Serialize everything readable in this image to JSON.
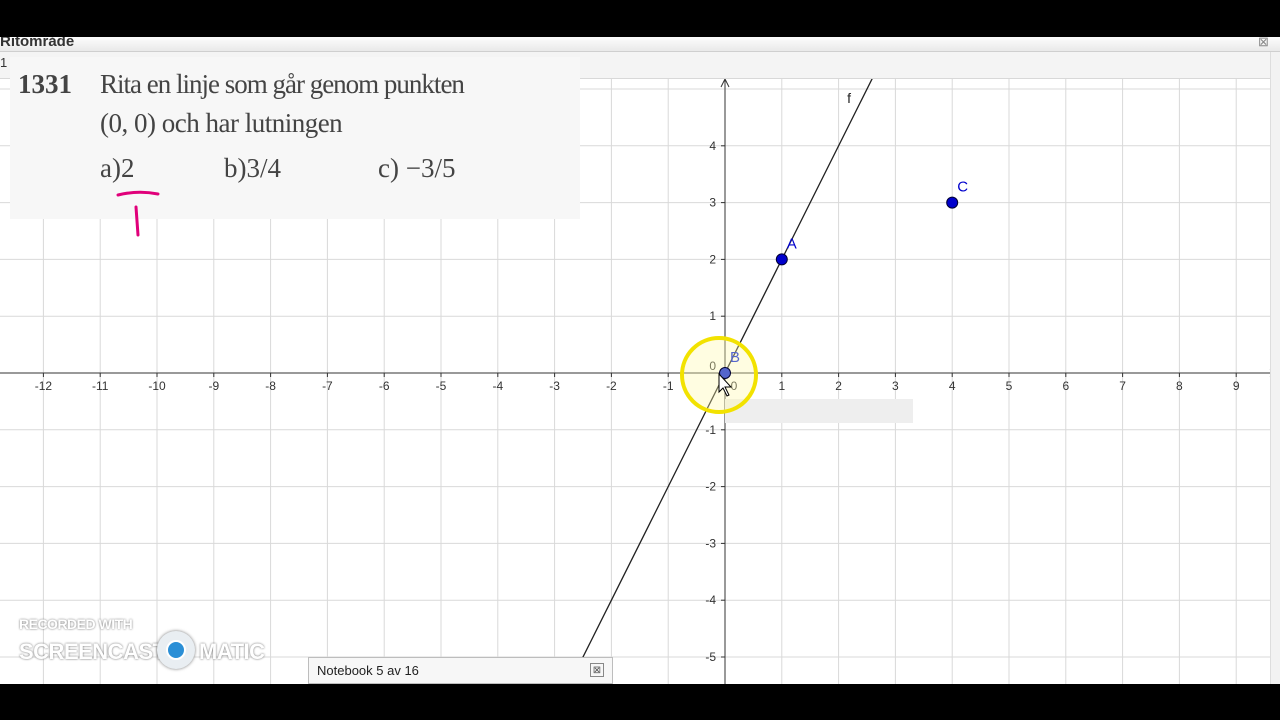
{
  "window": {
    "title": "Ritområde",
    "close_glyph": "⊠",
    "strip_label": "1"
  },
  "problem": {
    "number": "1331",
    "line1": "Rita en linje som går genom punkten",
    "line2": "(0, 0) och har lutningen",
    "option_a": "a)2",
    "option_b": "b)3/4",
    "option_c": "c) −3/5"
  },
  "annotation": {
    "color": "#e0007a",
    "shape": "fraction-bar-with-1-below-2"
  },
  "graph": {
    "x_ticks": [
      "-12",
      "-11",
      "-10",
      "-9",
      "-8",
      "-7",
      "-6",
      "-5",
      "-4",
      "-3",
      "-2",
      "-1",
      "0",
      "1",
      "2",
      "3",
      "4",
      "5",
      "6",
      "7",
      "8",
      "9"
    ],
    "y_ticks": [
      "-5",
      "-4",
      "-3",
      "-2",
      "-1",
      "0",
      "1",
      "2",
      "3",
      "4"
    ],
    "line": {
      "name": "f",
      "slope": 2,
      "intercept": 0,
      "color": "#222222"
    },
    "points": [
      {
        "name": "A",
        "x": 1,
        "y": 2,
        "color": "#0000cc"
      },
      {
        "name": "B",
        "x": 0,
        "y": 0,
        "color": "#5566cc"
      },
      {
        "name": "C",
        "x": 4,
        "y": 3,
        "color": "#0000cc"
      }
    ],
    "cursor_highlight_color": "#f2e200"
  },
  "watermark": {
    "top": "RECORDED WITH",
    "part_a": "SCREENCAST",
    "part_b": "MATIC"
  },
  "notebook": {
    "label": "Notebook  5 av 16",
    "close_glyph": "⊠"
  }
}
